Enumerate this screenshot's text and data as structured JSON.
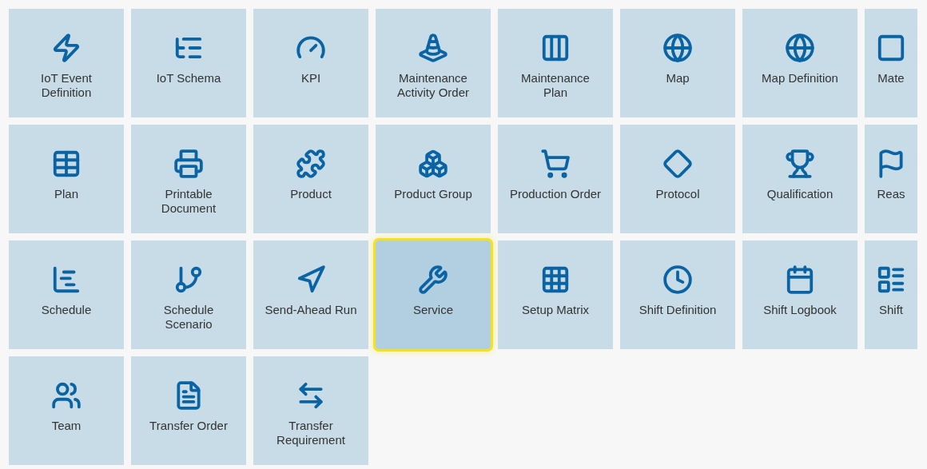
{
  "tiles": [
    {
      "label": "IoT Event Definition",
      "selected": false
    },
    {
      "label": "IoT Schema",
      "selected": false
    },
    {
      "label": "KPI",
      "selected": false
    },
    {
      "label": "Maintenance Activity Order",
      "selected": false
    },
    {
      "label": "Maintenance Plan",
      "selected": false
    },
    {
      "label": "Map",
      "selected": false
    },
    {
      "label": "Map Definition",
      "selected": false
    },
    {
      "label": "Mate",
      "selected": false
    },
    {
      "label": "Plan",
      "selected": false
    },
    {
      "label": "Printable Document",
      "selected": false
    },
    {
      "label": "Product",
      "selected": false
    },
    {
      "label": "Product Group",
      "selected": false
    },
    {
      "label": "Production Order",
      "selected": false
    },
    {
      "label": "Protocol",
      "selected": false
    },
    {
      "label": "Qualification",
      "selected": false
    },
    {
      "label": "Reas",
      "selected": false
    },
    {
      "label": "Schedule",
      "selected": false
    },
    {
      "label": "Schedule Scenario",
      "selected": false
    },
    {
      "label": "Send-Ahead Run",
      "selected": false
    },
    {
      "label": "Service",
      "selected": true
    },
    {
      "label": "Setup Matrix",
      "selected": false
    },
    {
      "label": "Shift Definition",
      "selected": false
    },
    {
      "label": "Shift Logbook",
      "selected": false
    },
    {
      "label": "Shift",
      "selected": false
    },
    {
      "label": "Team",
      "selected": false
    },
    {
      "label": "Transfer Order",
      "selected": false
    },
    {
      "label": "Transfer Requirement",
      "selected": false
    }
  ]
}
